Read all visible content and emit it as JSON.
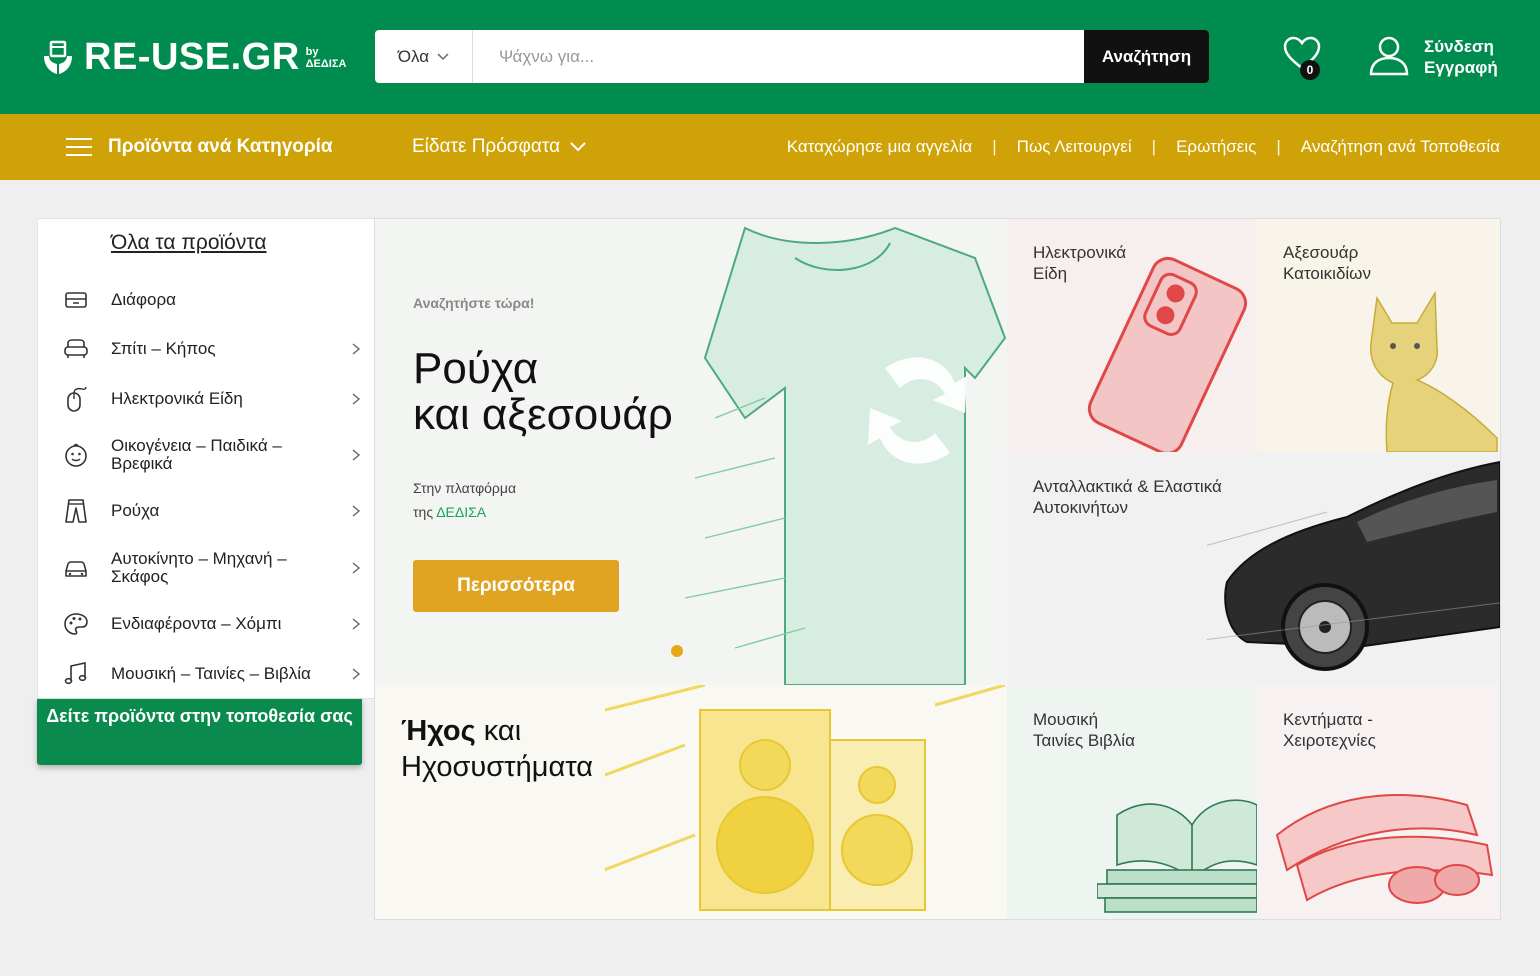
{
  "header": {
    "logo_text": "RE-USE.GR",
    "logo_by": "by",
    "logo_org": "ΔΕΔΙΣΑ",
    "search_category": "Όλα",
    "search_placeholder": "Ψάχνω για...",
    "search_button": "Αναζήτηση",
    "wishlist_count": "0",
    "login_label": "Σύνδεση",
    "register_label": "Εγγραφή"
  },
  "nav": {
    "categories_label": "Προϊόντα ανά Κατηγορία",
    "recent_label": "Είδατε Πρόσφατα",
    "links": [
      "Καταχώρησε μια αγγελία",
      "Πως Λειτουργεί",
      "Ερωτήσεις",
      "Αναζήτηση ανά Τοποθεσία"
    ],
    "separator": "|"
  },
  "sidebar": {
    "title": "Όλα τα προϊόντα",
    "items": [
      {
        "label": "Διάφορα",
        "icon": "box-icon",
        "has_submenu": false
      },
      {
        "label": "Σπίτι – Κήπος",
        "icon": "armchair-icon",
        "has_submenu": true
      },
      {
        "label": "Ηλεκτρονικά Είδη",
        "icon": "mouse-icon",
        "has_submenu": true
      },
      {
        "label": "Οικογένεια – Παιδικά – Βρεφικά",
        "icon": "baby-face-icon",
        "has_submenu": true
      },
      {
        "label": "Ρούχα",
        "icon": "trousers-icon",
        "has_submenu": true
      },
      {
        "label": "Αυτοκίνητο – Μηχανή – Σκάφος",
        "icon": "car-icon",
        "has_submenu": true
      },
      {
        "label": "Ενδιαφέροντα – Χόμπι",
        "icon": "palette-icon",
        "has_submenu": true
      },
      {
        "label": "Μουσική – Ταινίες – Βιβλία",
        "icon": "music-note-icon",
        "has_submenu": true
      }
    ],
    "location_button": "Δείτε προϊόντα στην τοποθεσία σας"
  },
  "hero": {
    "kicker": "Αναζητήστε τώρα!",
    "title_line1": "Ρούχα",
    "title_line2": "και αξεσουάρ",
    "sub_line1": "Στην πλατφόρμα",
    "sub_prefix": "της",
    "sub_brand": "ΔΕΔΙΣΑ",
    "button": "Περισσότερα",
    "illustration": "tshirt-recycle-illustration"
  },
  "tiles": {
    "electronics": "Ηλεκτρονικά Είδη",
    "pets": "Αξεσουάρ Κατοικιδίων",
    "car": "Ανταλλακτικά & Ελαστικά Αυτοκινήτων",
    "sound_bold": "Ήχος",
    "sound_rest1": "και",
    "sound_rest2": "Ηχοσυστήματα",
    "music": "Μουσική Ταινίες Βιβλία",
    "craft": "Κεντήματα - Χειροτεχνίες"
  },
  "colors": {
    "brand_green": "#008c4f",
    "nav_gold": "#cfa307",
    "hero_button": "#e0a422",
    "location_button": "#0a8a4d"
  }
}
